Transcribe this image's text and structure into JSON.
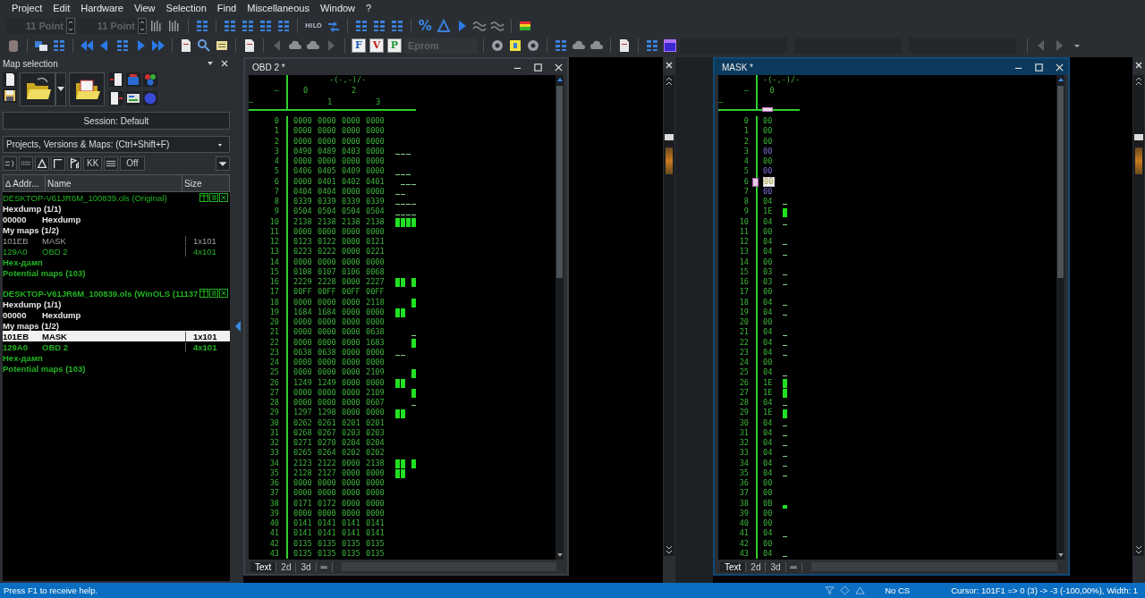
{
  "menu": [
    "Project",
    "Edit",
    "Hardware",
    "View",
    "Selection",
    "Find",
    "Miscellaneous",
    "Window",
    "?"
  ],
  "toolbar": {
    "font_fields": [
      {
        "value": "11 Point",
        "disabled": true
      },
      {
        "value": "11 Point",
        "disabled": true
      }
    ],
    "hilo_label": "HILO",
    "percent_label": "%",
    "letter_buttons": [
      {
        "label": "F",
        "color": "#1c5fb8"
      },
      {
        "label": "V",
        "color": "#c02020"
      },
      {
        "label": "P",
        "color": "#1e9a30"
      }
    ],
    "eprom_field": {
      "value": "Eprom",
      "disabled": true
    }
  },
  "map_selection": {
    "title": "Map selection",
    "session_button": "Session: Default",
    "search_dropdown": "Projects, Versions & Maps:  (Ctrl+Shift+F)",
    "filter_buttons": [
      "KK",
      "Off"
    ],
    "columns": [
      "∆ Addr...",
      "Name",
      "Size"
    ],
    "projects": [
      {
        "title": "DESKTOP-V61JR6M_100839.ols (Original)",
        "active": false,
        "rows": [
          {
            "kind": "section",
            "text": "Hexdump (1/1)",
            "green": false,
            "dimmed": false,
            "bold": true,
            "selected": false
          },
          {
            "kind": "map",
            "address": "00000",
            "name": "Hexdump",
            "green": false,
            "dimmed": false,
            "bold": true,
            "selected": false
          },
          {
            "kind": "section",
            "text": "My maps (1/2)",
            "green": false,
            "dimmed": false,
            "bold": true,
            "selected": false
          },
          {
            "kind": "map",
            "address": "101EB",
            "name": "MASK",
            "size": "1x101",
            "green": false,
            "dimmed": true,
            "bold": false,
            "selected": false
          },
          {
            "kind": "map",
            "address": "129A0",
            "name": "OBD 2",
            "size": "4x101",
            "green": true,
            "dimmed": false,
            "bold": false,
            "selected": false
          },
          {
            "kind": "section",
            "text": "Hex-дамп",
            "green": true,
            "dimmed": false,
            "bold": true,
            "selected": false
          },
          {
            "kind": "section",
            "text": "Potential maps (103)",
            "green": true,
            "dimmed": false,
            "bold": true,
            "selected": false
          }
        ]
      },
      {
        "title": "DESKTOP-V61JR6M_100839.ols (WinOLS (11137",
        "active": true,
        "rows": [
          {
            "kind": "section",
            "text": "Hexdump (1/1)",
            "green": false,
            "dimmed": false,
            "bold": true,
            "selected": false
          },
          {
            "kind": "map",
            "address": "00000",
            "name": "Hexdump",
            "green": false,
            "dimmed": false,
            "bold": true,
            "selected": false
          },
          {
            "kind": "section",
            "text": "My maps (1/2)",
            "green": false,
            "dimmed": false,
            "bold": true,
            "selected": false
          },
          {
            "kind": "map",
            "address": "101EB",
            "name": "MASK",
            "size": "1x101",
            "green": false,
            "dimmed": false,
            "bold": true,
            "selected": true
          },
          {
            "kind": "map",
            "address": "129A0",
            "name": "OBD 2",
            "size": "4x101",
            "green": true,
            "dimmed": false,
            "bold": true,
            "selected": false
          },
          {
            "kind": "section",
            "text": "Hex-дамп",
            "green": true,
            "dimmed": false,
            "bold": true,
            "selected": false
          },
          {
            "kind": "section",
            "text": "Potential maps (103)",
            "green": true,
            "dimmed": false,
            "bold": true,
            "selected": false
          }
        ]
      }
    ]
  },
  "obd_window": {
    "title": "OBD 2 *",
    "active": false,
    "axis_label": "-(-,-)/-",
    "corner_labels": [
      "–",
      "–"
    ],
    "columns": [
      "0",
      "1",
      "2",
      "3"
    ],
    "rows": [
      {
        "label": "0",
        "values": [
          "0000",
          "0000",
          "0000",
          "0000"
        ]
      },
      {
        "label": "1",
        "values": [
          "0000",
          "0000",
          "0000",
          "0000"
        ]
      },
      {
        "label": "2",
        "values": [
          "0000",
          "0000",
          "0000",
          "0000"
        ]
      },
      {
        "label": "3",
        "values": [
          "0490",
          "0489",
          "0403",
          "0000"
        ]
      },
      {
        "label": "4",
        "values": [
          "0000",
          "0000",
          "0000",
          "0000"
        ]
      },
      {
        "label": "5",
        "values": [
          "0406",
          "0405",
          "0409",
          "0000"
        ]
      },
      {
        "label": "6",
        "values": [
          "0000",
          "0401",
          "0402",
          "0401"
        ]
      },
      {
        "label": "7",
        "values": [
          "0404",
          "0404",
          "0000",
          "0000"
        ]
      },
      {
        "label": "8",
        "values": [
          "0339",
          "0339",
          "0339",
          "0339"
        ]
      },
      {
        "label": "9",
        "values": [
          "0504",
          "0504",
          "0504",
          "0504"
        ]
      },
      {
        "label": "10",
        "values": [
          "2138",
          "2138",
          "2138",
          "2138"
        ]
      },
      {
        "label": "11",
        "values": [
          "0000",
          "0000",
          "0000",
          "0000"
        ]
      },
      {
        "label": "12",
        "values": [
          "0123",
          "0122",
          "0000",
          "0121"
        ]
      },
      {
        "label": "13",
        "values": [
          "0223",
          "0222",
          "0000",
          "0221"
        ]
      },
      {
        "label": "14",
        "values": [
          "0000",
          "0000",
          "0000",
          "0000"
        ]
      },
      {
        "label": "15",
        "values": [
          "0108",
          "0107",
          "0106",
          "0068"
        ]
      },
      {
        "label": "16",
        "values": [
          "2229",
          "2228",
          "0000",
          "2227"
        ]
      },
      {
        "label": "17",
        "values": [
          "00FF",
          "00FF",
          "00FF",
          "00FF"
        ]
      },
      {
        "label": "18",
        "values": [
          "0000",
          "0000",
          "0000",
          "2118"
        ]
      },
      {
        "label": "19",
        "values": [
          "1684",
          "1684",
          "0000",
          "0000"
        ]
      },
      {
        "label": "20",
        "values": [
          "0000",
          "0000",
          "0000",
          "0000"
        ]
      },
      {
        "label": "21",
        "values": [
          "0000",
          "0000",
          "0000",
          "0638"
        ]
      },
      {
        "label": "22",
        "values": [
          "0000",
          "0000",
          "0000",
          "1683"
        ]
      },
      {
        "label": "23",
        "values": [
          "0638",
          "0638",
          "0000",
          "0000"
        ]
      },
      {
        "label": "24",
        "values": [
          "0000",
          "0000",
          "0000",
          "0000"
        ]
      },
      {
        "label": "25",
        "values": [
          "0000",
          "0000",
          "0000",
          "2109"
        ]
      },
      {
        "label": "26",
        "values": [
          "1249",
          "1249",
          "0000",
          "0000"
        ]
      },
      {
        "label": "27",
        "values": [
          "0000",
          "0000",
          "0000",
          "2109"
        ]
      },
      {
        "label": "28",
        "values": [
          "0000",
          "0000",
          "0000",
          "0607"
        ]
      },
      {
        "label": "29",
        "values": [
          "1297",
          "1298",
          "0000",
          "0000"
        ]
      },
      {
        "label": "30",
        "values": [
          "0262",
          "0261",
          "0201",
          "0201"
        ]
      },
      {
        "label": "31",
        "values": [
          "0268",
          "0267",
          "0203",
          "0203"
        ]
      },
      {
        "label": "32",
        "values": [
          "0271",
          "0270",
          "0204",
          "0204"
        ]
      },
      {
        "label": "33",
        "values": [
          "0265",
          "0264",
          "0202",
          "0202"
        ]
      },
      {
        "label": "34",
        "values": [
          "2123",
          "2122",
          "0000",
          "2138"
        ]
      },
      {
        "label": "35",
        "values": [
          "2128",
          "2127",
          "0000",
          "0000"
        ]
      },
      {
        "label": "36",
        "values": [
          "0000",
          "0000",
          "0000",
          "0000"
        ]
      },
      {
        "label": "37",
        "values": [
          "0000",
          "0000",
          "0000",
          "0000"
        ]
      },
      {
        "label": "38",
        "values": [
          "0171",
          "0172",
          "0000",
          "0000"
        ]
      },
      {
        "label": "39",
        "values": [
          "0000",
          "0000",
          "0000",
          "0000"
        ]
      },
      {
        "label": "40",
        "values": [
          "0141",
          "0141",
          "0141",
          "0141"
        ]
      },
      {
        "label": "41",
        "values": [
          "0141",
          "0141",
          "0141",
          "0141"
        ]
      },
      {
        "label": "42",
        "values": [
          "0135",
          "0135",
          "0135",
          "0135"
        ]
      },
      {
        "label": "43",
        "values": [
          "0135",
          "0135",
          "0135",
          "0135"
        ]
      }
    ],
    "view_tabs": [
      {
        "label": "Text",
        "selected": true
      },
      {
        "label": "2d",
        "selected": false
      },
      {
        "label": "3d",
        "selected": false
      },
      {
        "label": "═",
        "selected": false
      }
    ]
  },
  "mask_window": {
    "title": "MASK *",
    "active": true,
    "axis_label": "-(-,-)/-",
    "corner_labels": [
      "–",
      "–"
    ],
    "columns": [
      {
        "label": "0",
        "selected": true
      }
    ],
    "rows": [
      {
        "label": "0",
        "value": "00",
        "marked": false,
        "selected": false
      },
      {
        "label": "1",
        "value": "00",
        "marked": false,
        "selected": false
      },
      {
        "label": "2",
        "value": "00",
        "marked": false,
        "selected": false
      },
      {
        "label": "3",
        "value": "00",
        "marked": true,
        "selected": false
      },
      {
        "label": "4",
        "value": "00",
        "marked": false,
        "selected": false
      },
      {
        "label": "5",
        "value": "00",
        "marked": true,
        "selected": false
      },
      {
        "label": "6",
        "value": "00",
        "marked": false,
        "selected": true
      },
      {
        "label": "7",
        "value": "00",
        "marked": true,
        "selected": false
      },
      {
        "label": "8",
        "value": "04",
        "marked": false,
        "selected": false
      },
      {
        "label": "9",
        "value": "1E",
        "marked": false,
        "selected": false
      },
      {
        "label": "10",
        "value": "04",
        "marked": false,
        "selected": false
      },
      {
        "label": "11",
        "value": "00",
        "marked": false,
        "selected": false
      },
      {
        "label": "12",
        "value": "04",
        "marked": false,
        "selected": false
      },
      {
        "label": "13",
        "value": "04",
        "marked": false,
        "selected": false
      },
      {
        "label": "14",
        "value": "00",
        "marked": false,
        "selected": false
      },
      {
        "label": "15",
        "value": "03",
        "marked": false,
        "selected": false
      },
      {
        "label": "16",
        "value": "03",
        "marked": false,
        "selected": false
      },
      {
        "label": "17",
        "value": "00",
        "marked": false,
        "selected": false
      },
      {
        "label": "18",
        "value": "04",
        "marked": false,
        "selected": false
      },
      {
        "label": "19",
        "value": "04",
        "marked": false,
        "selected": false
      },
      {
        "label": "20",
        "value": "00",
        "marked": false,
        "selected": false
      },
      {
        "label": "21",
        "value": "04",
        "marked": false,
        "selected": false
      },
      {
        "label": "22",
        "value": "04",
        "marked": false,
        "selected": false
      },
      {
        "label": "23",
        "value": "04",
        "marked": false,
        "selected": false
      },
      {
        "label": "24",
        "value": "00",
        "marked": false,
        "selected": false
      },
      {
        "label": "25",
        "value": "04",
        "marked": false,
        "selected": false
      },
      {
        "label": "26",
        "value": "1E",
        "marked": false,
        "selected": false
      },
      {
        "label": "27",
        "value": "1E",
        "marked": false,
        "selected": false
      },
      {
        "label": "28",
        "value": "04",
        "marked": false,
        "selected": false
      },
      {
        "label": "29",
        "value": "1E",
        "marked": false,
        "selected": false
      },
      {
        "label": "30",
        "value": "04",
        "marked": false,
        "selected": false
      },
      {
        "label": "31",
        "value": "04",
        "marked": false,
        "selected": false
      },
      {
        "label": "32",
        "value": "04",
        "marked": false,
        "selected": false
      },
      {
        "label": "33",
        "value": "04",
        "marked": false,
        "selected": false
      },
      {
        "label": "34",
        "value": "04",
        "marked": false,
        "selected": false
      },
      {
        "label": "35",
        "value": "04",
        "marked": false,
        "selected": false
      },
      {
        "label": "36",
        "value": "00",
        "marked": false,
        "selected": false
      },
      {
        "label": "37",
        "value": "00",
        "marked": false,
        "selected": false
      },
      {
        "label": "38",
        "value": "0B",
        "marked": false,
        "selected": false
      },
      {
        "label": "39",
        "value": "00",
        "marked": false,
        "selected": false
      },
      {
        "label": "40",
        "value": "00",
        "marked": false,
        "selected": false
      },
      {
        "label": "41",
        "value": "04",
        "marked": false,
        "selected": false
      },
      {
        "label": "42",
        "value": "00",
        "marked": false,
        "selected": false
      },
      {
        "label": "43",
        "value": "04",
        "marked": false,
        "selected": false
      }
    ],
    "view_tabs": [
      {
        "label": "Text",
        "selected": true
      },
      {
        "label": "2d",
        "selected": false
      },
      {
        "label": "3d",
        "selected": false
      },
      {
        "label": "═",
        "selected": false
      }
    ]
  },
  "status_bar": {
    "help": "Press F1 to receive help.",
    "checksum": "No CS",
    "cursor": "Cursor: 101F1 => 0 (3) -> -3 (-100,00%), Width: 1"
  }
}
